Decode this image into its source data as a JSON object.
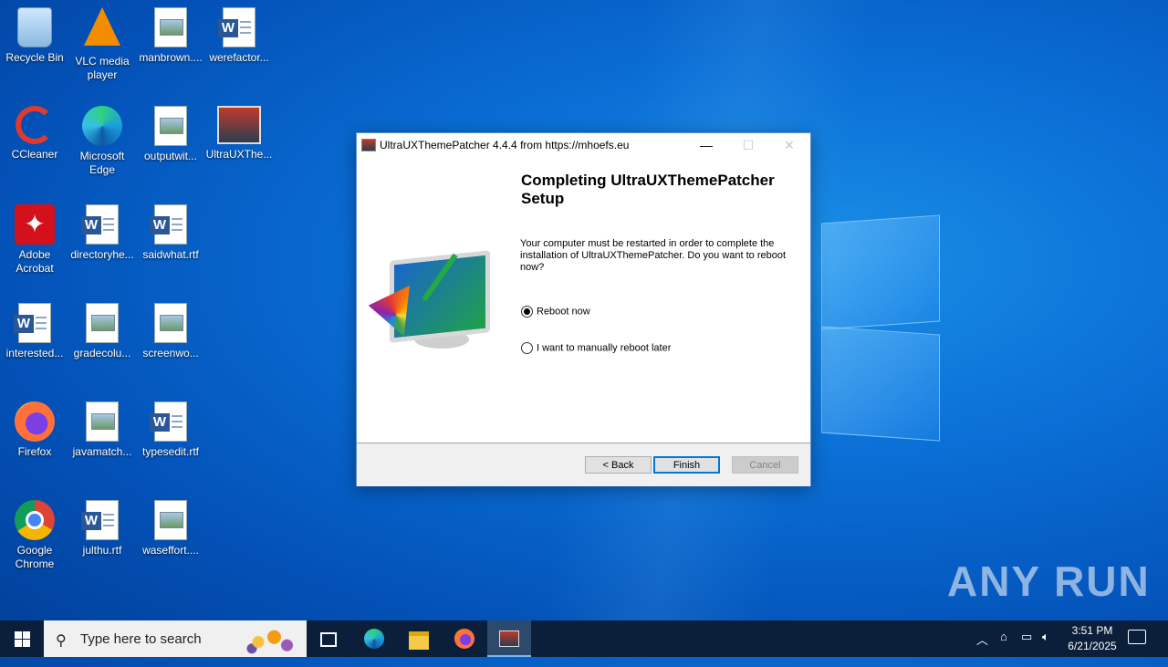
{
  "desktop": {
    "icons": [
      {
        "label": "Recycle Bin"
      },
      {
        "label": "VLC media player"
      },
      {
        "label": "manbrown...."
      },
      {
        "label": "werefactor..."
      },
      {
        "label": "CCleaner"
      },
      {
        "label": "Microsoft Edge"
      },
      {
        "label": "outputwit..."
      },
      {
        "label": "UltraUXThe..."
      },
      {
        "label": "Adobe Acrobat"
      },
      {
        "label": "directoryhe..."
      },
      {
        "label": "saidwhat.rtf"
      },
      {
        "label": "interested..."
      },
      {
        "label": "gradecolu..."
      },
      {
        "label": "screenwo..."
      },
      {
        "label": "Firefox"
      },
      {
        "label": "javamatch..."
      },
      {
        "label": "typesedit.rtf"
      },
      {
        "label": "Google Chrome"
      },
      {
        "label": "julthu.rtf"
      },
      {
        "label": "waseffort...."
      }
    ],
    "watermark": "ANY RUN"
  },
  "dialog": {
    "title": "UltraUXThemePatcher 4.4.4 from https://mhoefs.eu",
    "heading": "Completing UltraUXThemePatcher Setup",
    "description": "Your computer must be restarted in order to complete the installation of UltraUXThemePatcher. Do you want to reboot now?",
    "options": [
      {
        "label": "Reboot now",
        "selected": true
      },
      {
        "label": "I want to manually reboot later",
        "selected": false
      }
    ],
    "buttons": {
      "back": "< Back",
      "finish": "Finish",
      "cancel": "Cancel"
    }
  },
  "taskbar": {
    "search_placeholder": "Type here to search",
    "time": "3:51 PM",
    "date": "6/21/2025"
  }
}
